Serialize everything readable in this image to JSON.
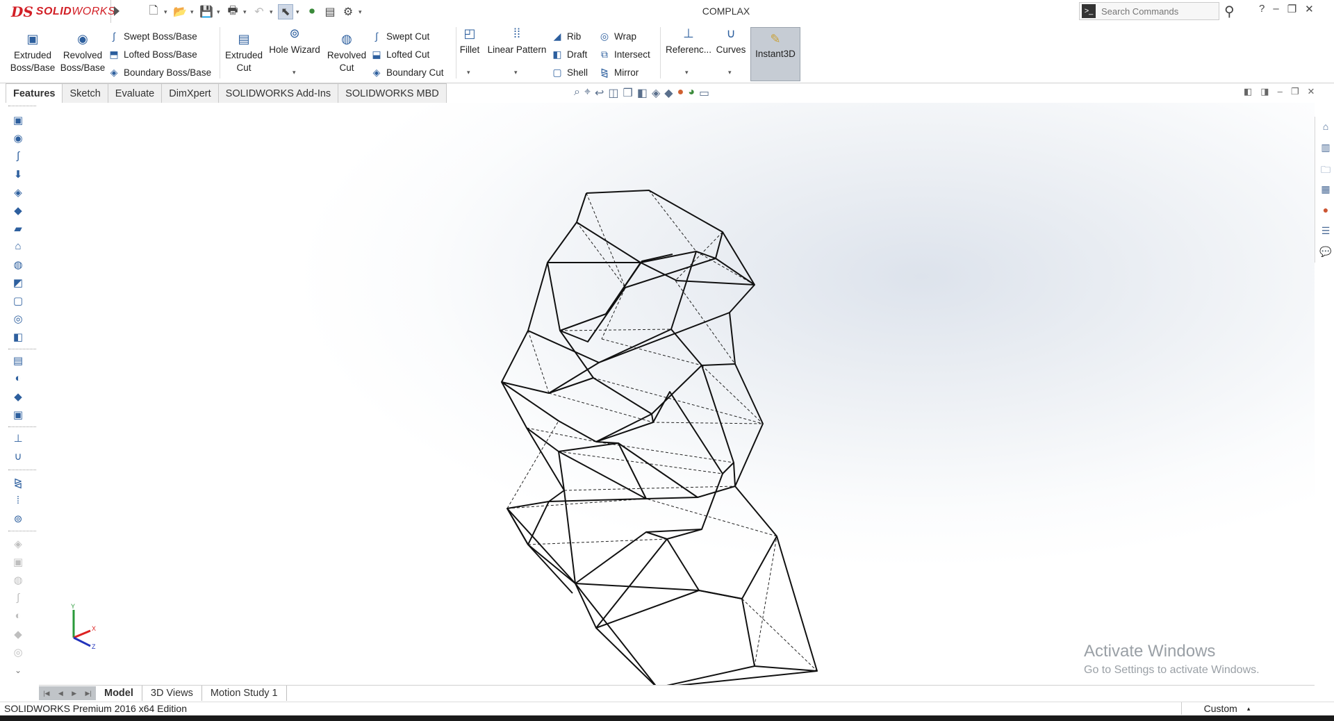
{
  "app": {
    "logo_mark": "DS",
    "logo_text_bold": "SOLID",
    "logo_text_light": "WORKS",
    "document_title": "COMPLAX"
  },
  "search": {
    "placeholder": "Search Commands"
  },
  "window_controls": {
    "help": "?",
    "minimize": "–",
    "restore": "❐",
    "close": "✕"
  },
  "ribbon": {
    "extruded_boss": "Extruded\nBoss/Base",
    "revolved_boss": "Revolved\nBoss/Base",
    "swept_boss": "Swept Boss/Base",
    "lofted_boss": "Lofted Boss/Base",
    "boundary_boss": "Boundary Boss/Base",
    "extruded_cut": "Extruded\nCut",
    "hole_wizard": "Hole Wizard",
    "revolved_cut": "Revolved\nCut",
    "swept_cut": "Swept Cut",
    "lofted_cut": "Lofted Cut",
    "boundary_cut": "Boundary Cut",
    "fillet": "Fillet",
    "linear_pattern": "Linear Pattern",
    "rib": "Rib",
    "draft": "Draft",
    "shell": "Shell",
    "wrap": "Wrap",
    "intersect": "Intersect",
    "mirror": "Mirror",
    "reference": "Referenc...",
    "curves": "Curves",
    "instant3d": "Instant3D"
  },
  "tabs": [
    {
      "label": "Features",
      "active": true
    },
    {
      "label": "Sketch",
      "active": false
    },
    {
      "label": "Evaluate",
      "active": false
    },
    {
      "label": "DimXpert",
      "active": false
    },
    {
      "label": "SOLIDWORKS Add-Ins",
      "active": false
    },
    {
      "label": "SOLIDWORKS MBD",
      "active": false
    }
  ],
  "viewport": {
    "watermark_title": "Activate Windows",
    "watermark_sub": "Go to Settings to activate Windows."
  },
  "triad": {
    "x": "X",
    "y": "Y",
    "z": "Z"
  },
  "bottom_tabs": [
    {
      "label": "Model",
      "active": true
    },
    {
      "label": "3D Views",
      "active": false
    },
    {
      "label": "Motion Study 1",
      "active": false
    }
  ],
  "status": {
    "edition": "SOLIDWORKS Premium 2016 x64 Edition",
    "units": "Custom"
  },
  "colors": {
    "brand_red": "#d21f26",
    "icon_blue": "#2d5f9e",
    "instant3d_active": "#c6ccd4"
  }
}
